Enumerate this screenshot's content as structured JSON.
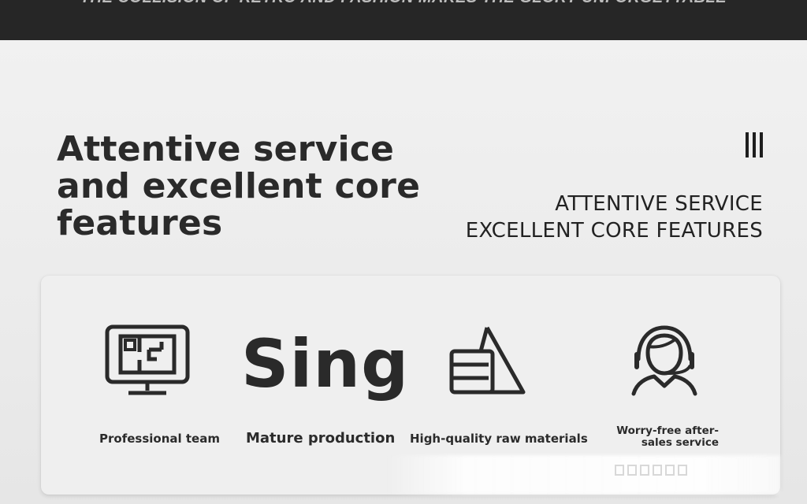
{
  "banner": {
    "tagline": "THE COLLISION OF RETRO AND FASHION MAKES THE GLORY UNFORGETTABLE"
  },
  "header": {
    "title": "Attentive service and excellent core features",
    "subtitle_line1": "ATTENTIVE SERVICE",
    "subtitle_line2": "EXCELLENT CORE FEATURES"
  },
  "features": {
    "brand_word": "Sing",
    "items": [
      {
        "label": "Professional team",
        "icon": "monitor-floorplan-icon"
      },
      {
        "label": "Mature production",
        "icon": "brand-text"
      },
      {
        "label": "High-quality raw materials",
        "icon": "triangle-stack-icon"
      },
      {
        "label": "Worry-free after-sales service",
        "icon": "headset-agent-icon"
      }
    ]
  },
  "colors": {
    "banner": "#262626",
    "background": "#ececec",
    "text": "#262626",
    "card": "#efefef"
  }
}
